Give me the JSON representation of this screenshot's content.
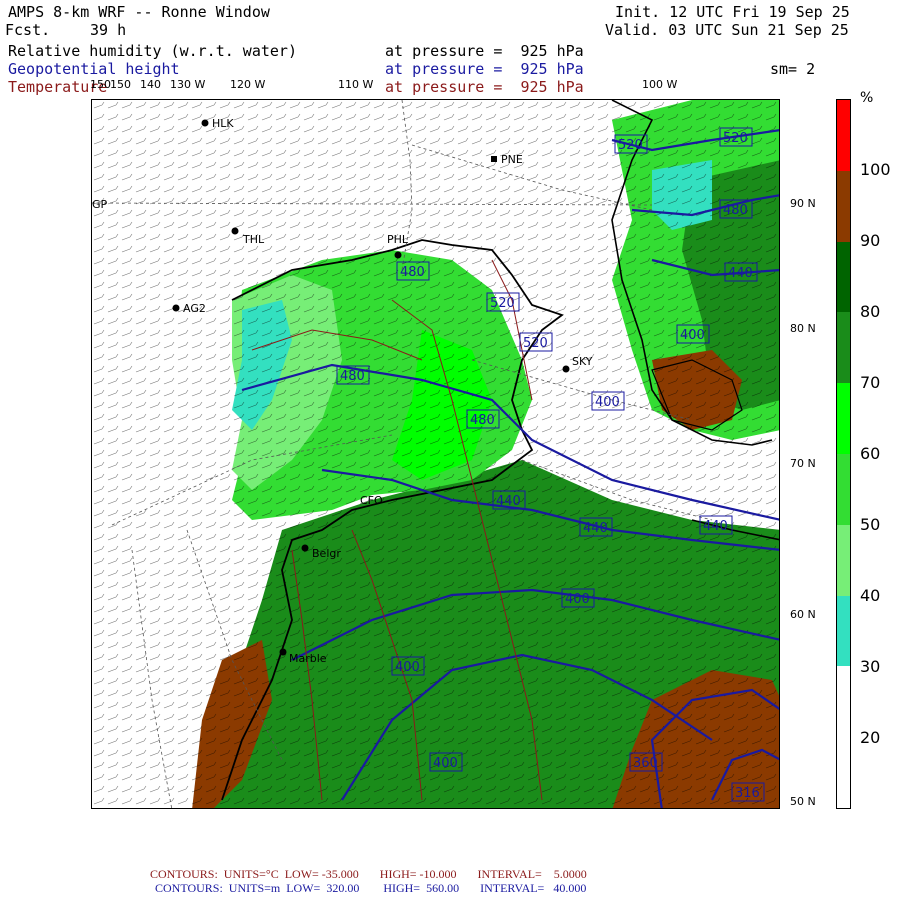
{
  "header": {
    "title": "AMPS 8-km WRF -- Ronne Window",
    "init": "Init. 12 UTC Fri 19 Sep 25",
    "fcst_label": "Fcst.",
    "fcst_value": "39 h",
    "valid": "Valid. 03 UTC Sun 21 Sep 25",
    "sm": "sm= 2"
  },
  "fields": [
    {
      "name": "Relative humidity (w.r.t. water)",
      "level": "at pressure =  925 hPa",
      "color": "#000000"
    },
    {
      "name": "Geopotential height",
      "level": "at pressure =  925 hPa",
      "color": "#1a1aa0"
    },
    {
      "name": "Temperature",
      "level": "at pressure =  925 hPa",
      "color": "#8b1a1a"
    }
  ],
  "lon_labels": [
    "150",
    "150",
    "140",
    "130 W",
    "120 W",
    "110 W",
    "100 W"
  ],
  "lat_labels": [
    "90 N",
    "80 N",
    "70 N",
    "60 N",
    "50 N"
  ],
  "stations": [
    {
      "id": "HLK"
    },
    {
      "id": "PNE"
    },
    {
      "id": "THL"
    },
    {
      "id": "PHL"
    },
    {
      "id": "AG2"
    },
    {
      "id": "SKY"
    },
    {
      "id": "CFO"
    },
    {
      "id": "Belgr"
    },
    {
      "id": "Marble"
    }
  ],
  "misc_map_labels": [
    "GP"
  ],
  "height_contours": [
    "520",
    "520",
    "480",
    "440",
    "400",
    "480",
    "520",
    "480",
    "520",
    "480",
    "400",
    "440",
    "440",
    "440",
    "400",
    "400",
    "400",
    "360",
    "316"
  ],
  "colorbar": {
    "unit": "%",
    "labels": [
      "100",
      "90",
      "80",
      "70",
      "60",
      "50",
      "40",
      "30",
      "20"
    ],
    "bins": [
      {
        "color": "#ff0000"
      },
      {
        "color": "#8b3a00"
      },
      {
        "color": "#006400"
      },
      {
        "color": "#1a8c1a"
      },
      {
        "color": "#00ff00"
      },
      {
        "color": "#33dd33"
      },
      {
        "color": "#77ee77"
      },
      {
        "color": "#33e0c0"
      },
      {
        "color": "#ffffff"
      },
      {
        "color": "#ffffff"
      }
    ]
  },
  "footer": {
    "temp_line": "CONTOURS:  UNITS=°C  LOW= -35.000       HIGH= -10.000       INTERVAL=    5.0000",
    "height_line": "CONTOURS:  UNITS=m  LOW=  320.00        HIGH=  560.00       INTERVAL=   40.000"
  },
  "colors": {
    "height_contour": "#1a1aa0",
    "temp_contour": "#8b1a1a",
    "coast": "#000000"
  }
}
